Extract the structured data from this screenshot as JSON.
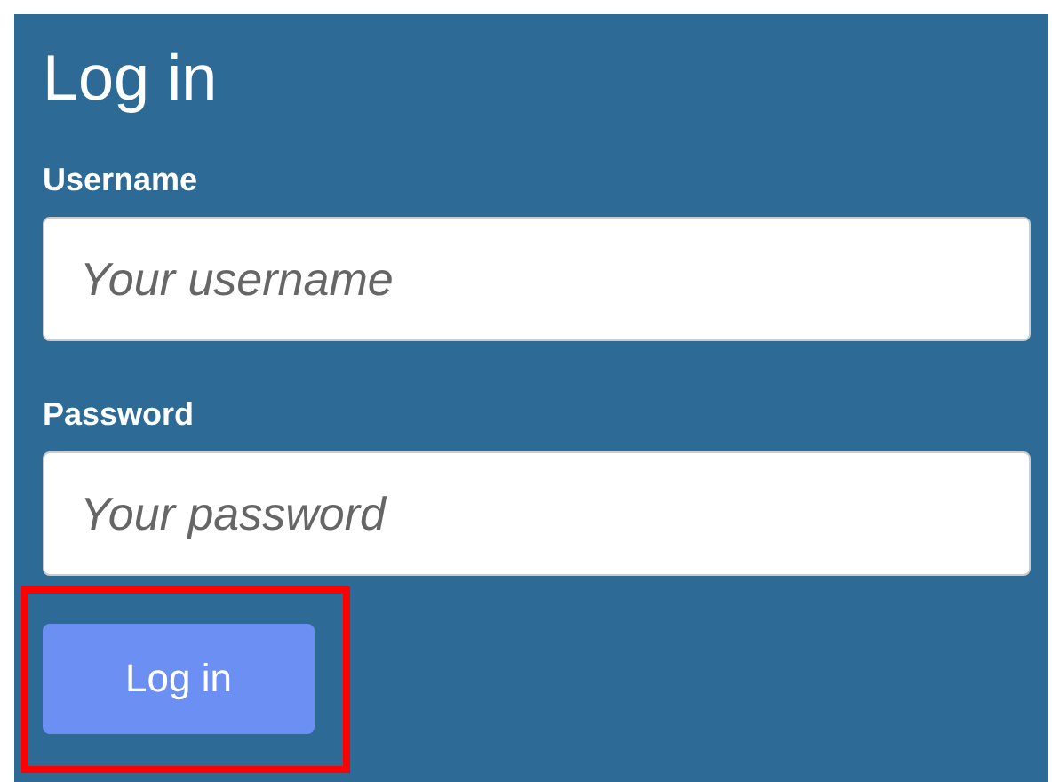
{
  "title": "Log in",
  "fields": [
    {
      "label": "Username",
      "placeholder": "Your username"
    },
    {
      "label": "Password",
      "placeholder": "Your password"
    }
  ],
  "button": {
    "label": "Log in",
    "highlighted": true
  }
}
